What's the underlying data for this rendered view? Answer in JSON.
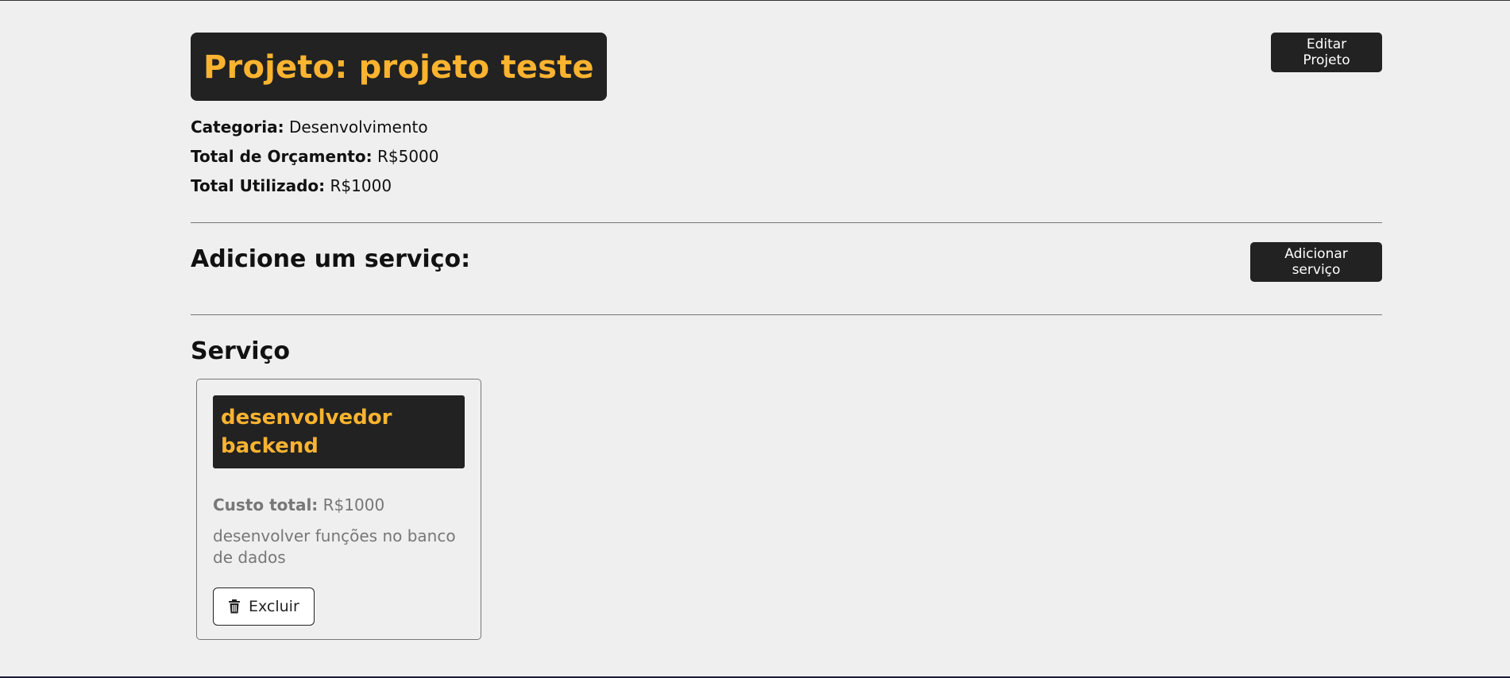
{
  "project": {
    "title": "Projeto: projeto teste",
    "edit_label": "Editar Projeto",
    "category_label": "Categoria:",
    "category_value": "Desenvolvimento",
    "budget_label": "Total de Orçamento:",
    "budget_value": "R$5000",
    "used_label": "Total Utilizado:",
    "used_value": "R$1000"
  },
  "add_service": {
    "title": "Adicione um serviço:",
    "button_label": "Adicionar serviço"
  },
  "services": {
    "title": "Serviço",
    "items": [
      {
        "name": "desenvolvedor backend",
        "cost_label": "Custo total:",
        "cost_value": "R$1000",
        "description": "desenvolver funções no banco de dados",
        "delete_label": "Excluir",
        "delete_icon": "trash-icon"
      }
    ]
  },
  "colors": {
    "background": "#efefef",
    "dark": "#222222",
    "accent": "#fbb330",
    "muted_text": "#777777"
  }
}
